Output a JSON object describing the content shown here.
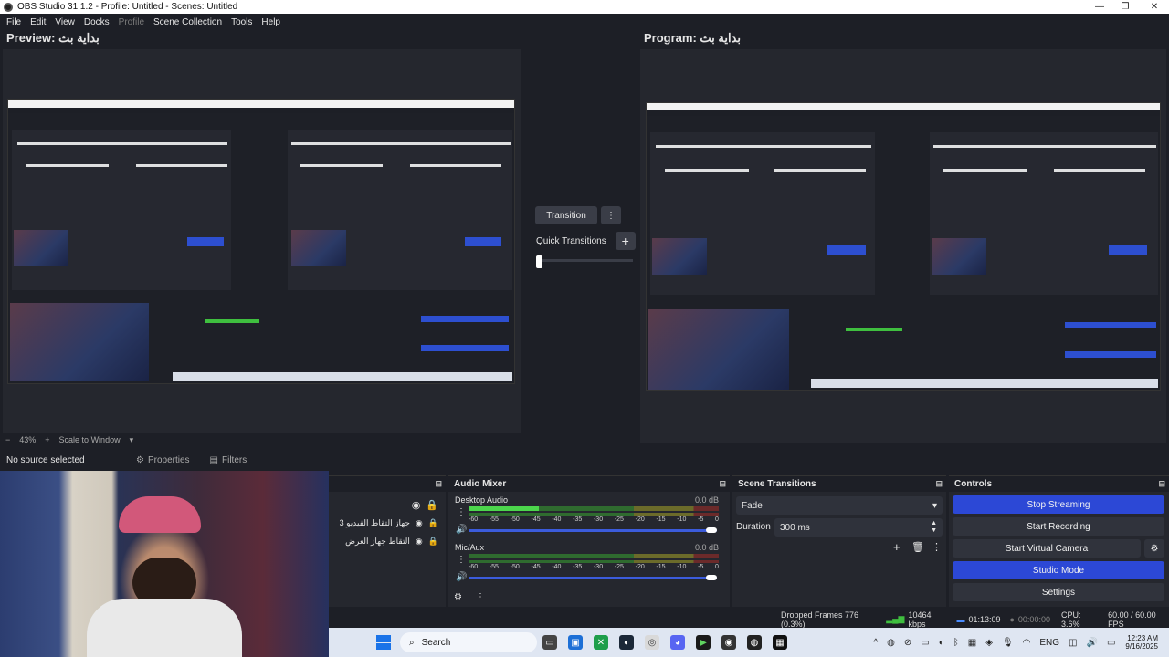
{
  "window": {
    "title": "OBS Studio 31.1.2 - Profile: Untitled - Scenes: Untitled",
    "controls": [
      "—",
      "❐",
      "✕"
    ]
  },
  "menu": [
    "File",
    "Edit",
    "View",
    "Docks",
    "Profile",
    "Scene Collection",
    "Tools",
    "Help"
  ],
  "preview": {
    "title": "Preview: بداية بث"
  },
  "program": {
    "title": "Program: بداية بث"
  },
  "zoom": {
    "minus": "−",
    "level": "43%",
    "plus": "+",
    "scale_mode": "Scale to Window"
  },
  "transition": {
    "button_label": "Transition",
    "quick_transitions_label": "Quick Transitions",
    "add_symbol": "+",
    "more_symbol": "⋮"
  },
  "source_bar": {
    "status": "No source selected",
    "properties_label": "Properties",
    "filters_label": "Filters"
  },
  "sources": [
    {
      "label": ""
    },
    {
      "label": "جهاز التقاط الفيديو 3"
    },
    {
      "label": "التقاط جهاز العرض"
    }
  ],
  "audio_mixer": {
    "title": "Audio Mixer",
    "channels": [
      {
        "name": "Desktop Audio",
        "db": "0.0 dB",
        "level": 0.28
      },
      {
        "name": "Mic/Aux",
        "db": "0.0 dB",
        "level": 0.0
      }
    ],
    "ticks": [
      "-60",
      "-55",
      "-50",
      "-45",
      "-40",
      "-35",
      "-30",
      "-25",
      "-20",
      "-15",
      "-10",
      "-5",
      "0"
    ]
  },
  "scene_transitions": {
    "title": "Scene Transitions",
    "selected": "Fade",
    "duration_label": "Duration",
    "duration_value": "300 ms"
  },
  "controls": {
    "title": "Controls",
    "stop_streaming": "Stop Streaming",
    "start_recording": "Start Recording",
    "start_virtual_camera": "Start Virtual Camera",
    "studio_mode": "Studio Mode",
    "settings": "Settings",
    "accent": "#2c48d6"
  },
  "status": {
    "dropped_frames": "Dropped Frames 776 (0.3%)",
    "bitrate": "10464 kbps",
    "stream_time": "01:13:09",
    "record_time": "00:00:00",
    "cpu": "CPU: 3.6%",
    "fps": "60.00 / 60.00 FPS"
  },
  "taskbar": {
    "search_placeholder": "Search",
    "language": "ENG",
    "time": "12:23 AM",
    "date": "9/16/2025"
  }
}
